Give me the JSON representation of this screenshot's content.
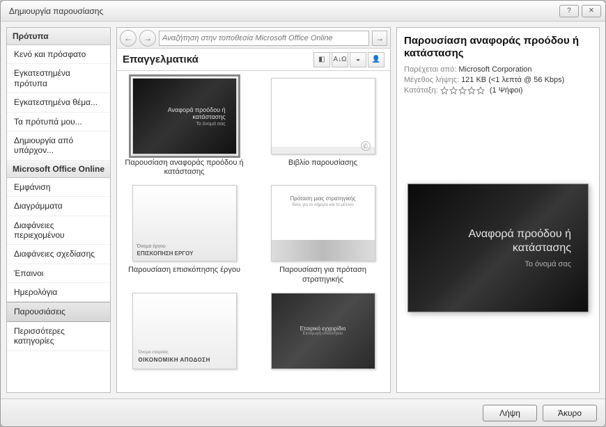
{
  "window": {
    "title": "Δημιουργία παρουσίασης",
    "help_label": "?",
    "close_label": "✕"
  },
  "sidebar": {
    "header1": "Πρότυπα",
    "items1": [
      "Κενό και πρόσφατο",
      "Εγκατεστημένα πρότυπα",
      "Εγκατεστημένα θέμα...",
      "Τα πρότυπά μου...",
      "Δημιουργία από υπάρχον..."
    ],
    "header2": "Microsoft Office Online",
    "items2": [
      "Εμφάνιση",
      "Διαγράμματα",
      "Διαφάνειες περιεχομένου",
      "Διαφάνειες σχεδίασης",
      "Έπαινοι",
      "Ημερολόγια",
      "Παρουσιάσεις",
      "Περισσότερες κατηγορίες"
    ],
    "selected": "Παρουσιάσεις"
  },
  "nav": {
    "back": "←",
    "forward": "→",
    "search_placeholder": "Αναζήτηση στην τοποθεσία Microsoft Office Online",
    "go": "→"
  },
  "category": {
    "title": "Επαγγελματικά",
    "tools": [
      "◧",
      "A↓Ω",
      "◒",
      "👤"
    ]
  },
  "templates": [
    {
      "caption": "Παρουσίαση αναφοράς προόδου ή κατάστασης",
      "kind": "dark",
      "selected": true,
      "t1": "Αναφορά προόδου ή",
      "t2": "κατάστασης",
      "t3": "Το όνομά σας"
    },
    {
      "caption": "Βιβλίο παρουσίασης",
      "kind": "white"
    },
    {
      "caption": "Παρουσίαση επισκόπησης έργου",
      "kind": "light",
      "t1": "Όνομα έργου",
      "t2": "ΕΠΙΣΚΟΠΗΣΗ ΕΡΓΟΥ"
    },
    {
      "caption": "Παρουσίαση για πρόταση στρατηγικής",
      "kind": "strategy",
      "t1": "Πρόταση μιας στρατηγικής",
      "t2": "Ιδέες για το σήμερα και το μέλλον"
    },
    {
      "caption": "",
      "kind": "fin",
      "t1": "Όνομα εταιρείας",
      "t2": "ΟΙΚΟΝΟΜΙΚΗ ΑΠΟΔΟΣΗ"
    },
    {
      "caption": "",
      "kind": "corp",
      "t1": "Εταιρικό εγχειρίδιο",
      "t2": "Εισαγωγή υπαλλήλου"
    }
  ],
  "preview": {
    "title": "Παρουσίαση αναφοράς προόδου ή κατάστασης",
    "provided_label": "Παρέχεται από:",
    "provided_val": "Microsoft Corporation",
    "size_label": "Μέγεθος λήψης:",
    "size_val": "121 KB (<1 λεπτά @ 56 Kbps)",
    "rating_label": "Κατάταξη:",
    "votes": "(1 Ψήφοι)",
    "slide_line1": "Αναφορά προόδου ή κατάστασης",
    "slide_line2": "Το όνομά σας"
  },
  "footer": {
    "download": "Λήψη",
    "cancel": "Άκυρο"
  }
}
